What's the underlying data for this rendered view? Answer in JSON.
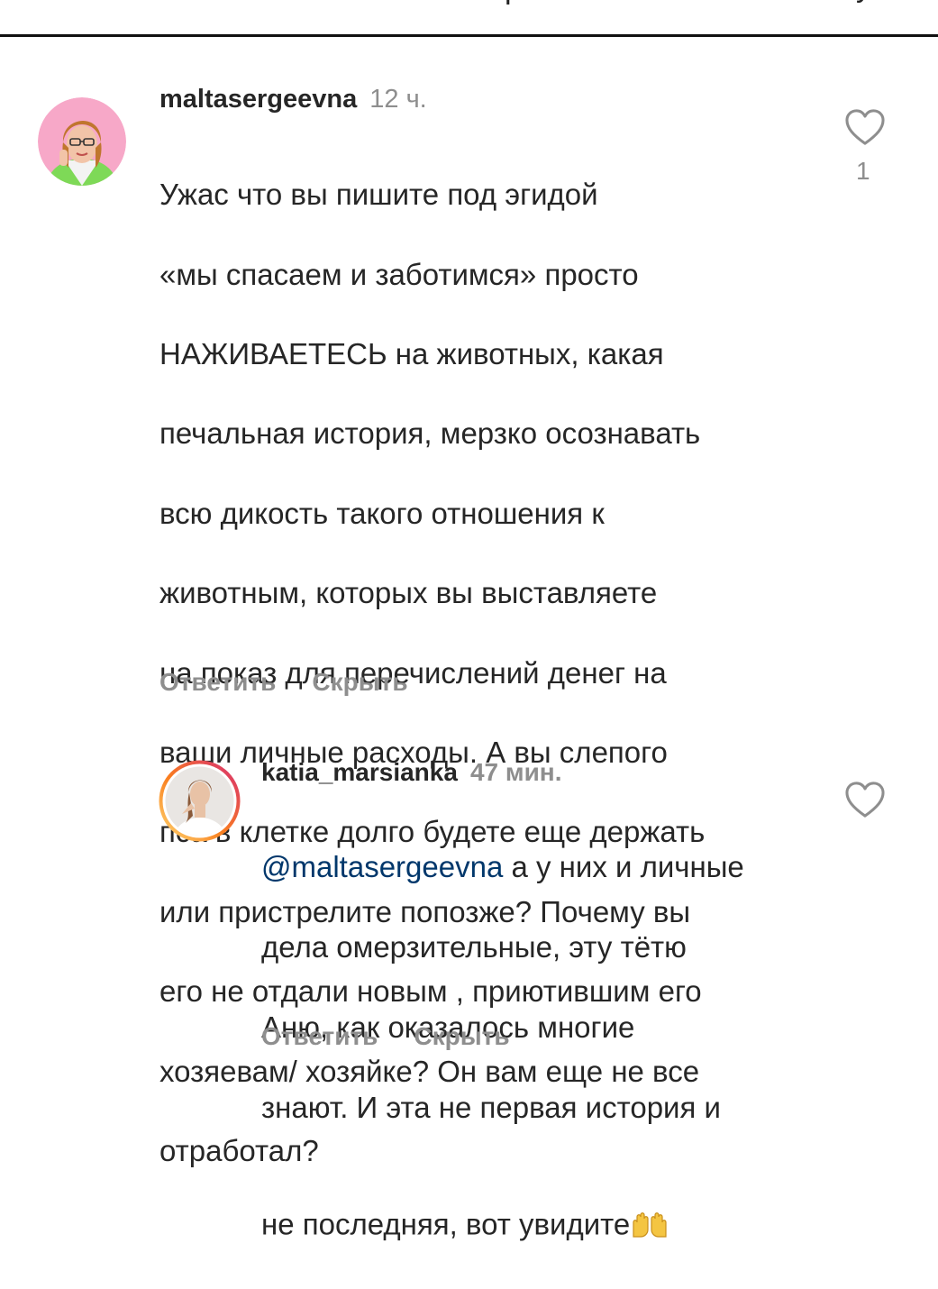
{
  "comments": [
    {
      "username": "maltasergeevna",
      "time": "12 ч.",
      "text_lines": [
        "Ужас что вы пишите под эгидой",
        "«мы спасаем и заботимся» просто",
        "НАЖИВАЕТЕСЬ на животных, какая",
        "печальная история, мерзко осознавать",
        "всю дикость такого отношения к",
        "животным, которых вы выставляете",
        "на показ для перечислений денег на",
        "ваши личные расходы. А вы слепого",
        "пса в клетке долго будете еще держать",
        "или пристрелите попозже? Почему вы",
        "его не отдали новым , приютившим его",
        "хозяевам/ хозяйке? Он вам еще не все",
        "отработал?"
      ],
      "like_count": "1",
      "reply_label": "Ответить",
      "hide_label": "Скрыть"
    },
    {
      "username": "katia_marsianka",
      "time": "47 мин.",
      "mention": "@maltasergeevna",
      "text_first_rest": " а у них и личные",
      "text_lines": [
        "дела омерзительные, эту тётю",
        "Аню, как оказалось многие",
        "знают. И эта не первая история и",
        "не последняя, вот увидите"
      ],
      "emoji": "🙌",
      "reply_label": "Ответить",
      "hide_label": "Скрыть"
    }
  ],
  "icons": {
    "like": "heart-outline-icon"
  },
  "colors": {
    "text": "#262626",
    "secondary": "#8e8e8e",
    "mention": "#00376b",
    "story_ring_start": "#feda75",
    "story_ring_end": "#d62976"
  }
}
